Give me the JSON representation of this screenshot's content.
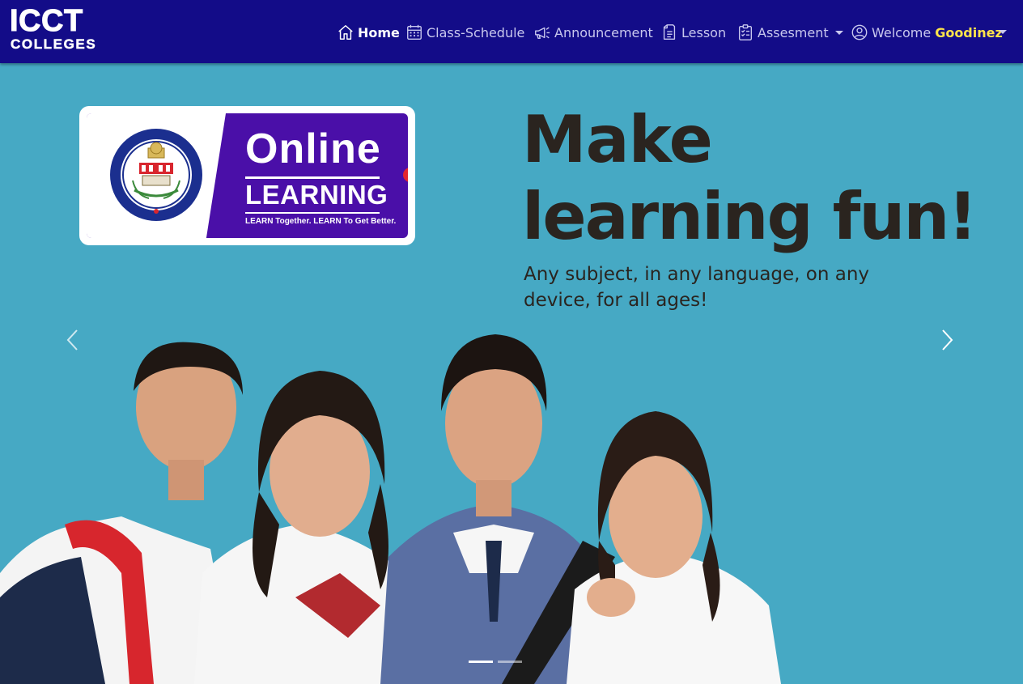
{
  "brand": {
    "line1": "ICCT",
    "line2": "COLLEGES"
  },
  "nav": {
    "items": [
      {
        "label": "Home",
        "icon": "house-icon",
        "active": true
      },
      {
        "label": "Class-Schedule",
        "icon": "calendar-icon",
        "active": false
      },
      {
        "label": "Announcement",
        "icon": "megaphone-icon",
        "active": false
      },
      {
        "label": "Lesson",
        "icon": "document-icon",
        "active": false
      },
      {
        "label": "Assesment",
        "icon": "checklist-icon",
        "active": false,
        "dropdown": true
      }
    ],
    "welcome_label": "Welcome",
    "user_name": "Goodinez",
    "user_icon": "user-circle-icon"
  },
  "hero": {
    "badge_title1": "Online",
    "badge_title2": "LEARNING",
    "badge_tagline": "LEARN Together. LEARN To Get Better.",
    "headline_line1": "Make",
    "headline_line2": "learning fun!",
    "subtext": "Any subject, in any language, on any device, for all ages!"
  },
  "carousel": {
    "slide_count": 2,
    "active_index": 0
  },
  "colors": {
    "navbar": "#130c88",
    "hero_bg": "#46a9c4",
    "welcome_name": "#ffe44a",
    "badge_purple": "#4a0fa8",
    "headline_text": "#2a241f"
  }
}
